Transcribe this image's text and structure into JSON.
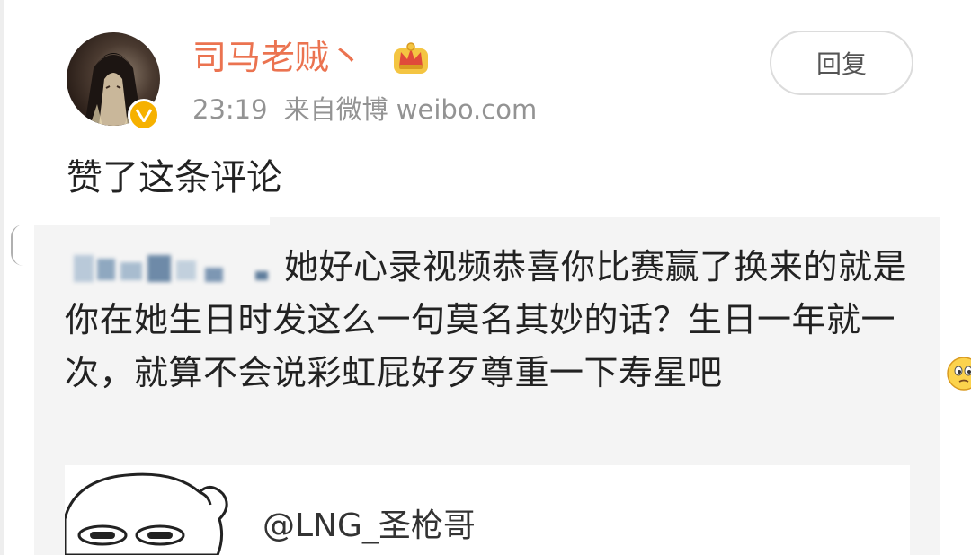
{
  "post": {
    "username": "司马老贼丶",
    "time": "23:19",
    "source": "来自微博 weibo.com",
    "action": "赞了这条评论",
    "reply_label": "回复"
  },
  "comment": {
    "text": "她好心录视频恭喜你比赛赢了换来的就是你在她生日时发这么一句莫名其妙的话？生日一年就一次，就算不会说彩虹屁好歹尊重一下寿星吧"
  },
  "quoted": {
    "username": "@LNG_圣枪哥"
  },
  "colors": {
    "username": "#eb7350",
    "meta": "#939393",
    "panel_bg": "#f4f4f4",
    "verified": "#f6b100"
  },
  "icons": {
    "crown": "crown-icon",
    "verified": "verified-badge-icon",
    "emoji": "thinking-emoji-icon"
  }
}
